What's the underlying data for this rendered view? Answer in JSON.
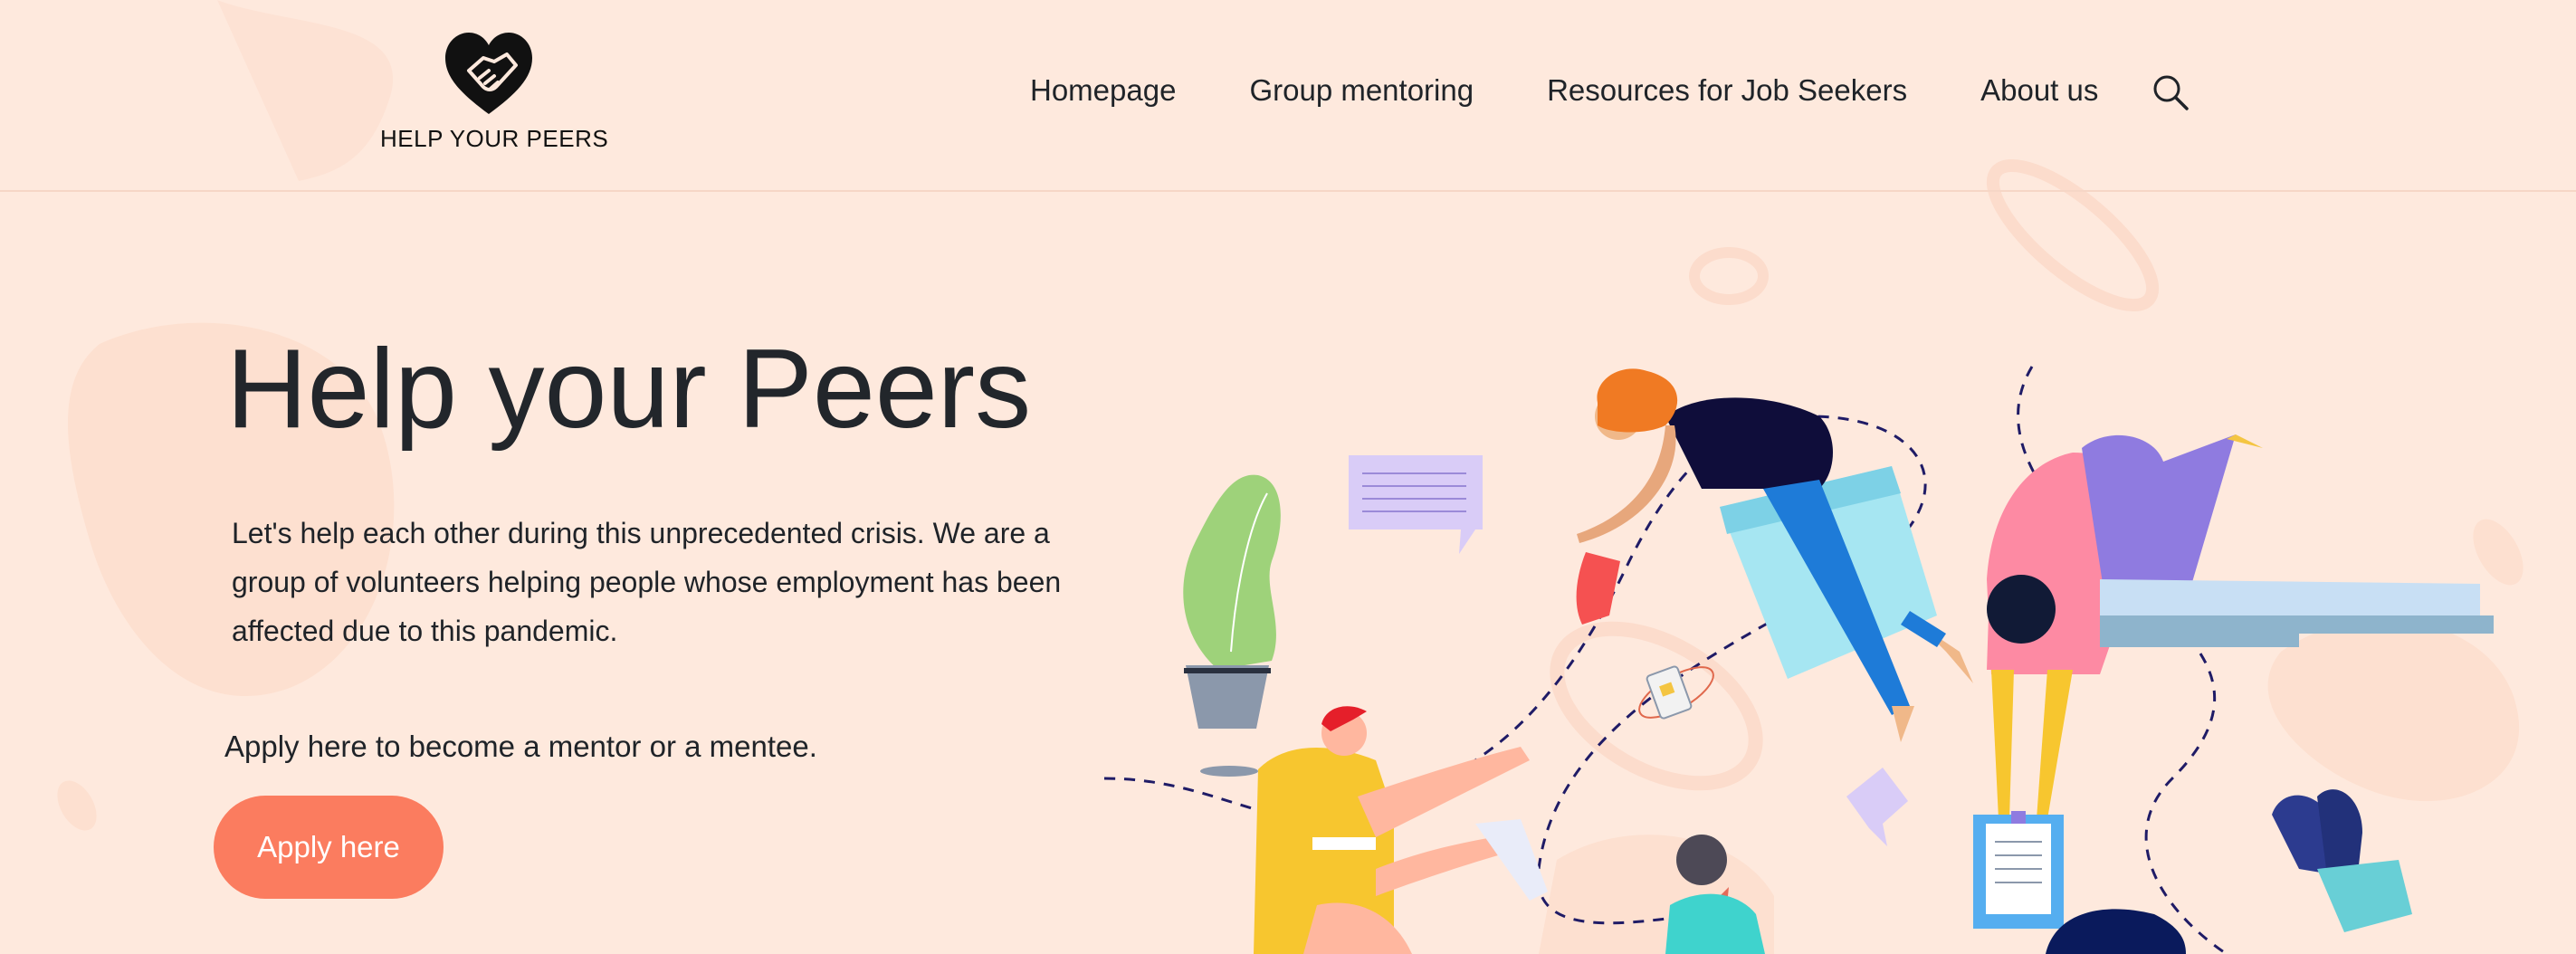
{
  "brand": {
    "logo_text": "HELP YOUR PEERS"
  },
  "nav": {
    "items": [
      {
        "label": "Homepage"
      },
      {
        "label": "Group mentoring"
      },
      {
        "label": "Resources for Job Seekers"
      },
      {
        "label": "About us"
      }
    ],
    "search_icon": "search-icon"
  },
  "hero": {
    "title": "Help your Peers",
    "description": "Let's help each other during this unprecedented crisis. We are a group of volunteers helping people whose employment has been affected due to this pandemic.",
    "apply_note": "Apply here to become a mentor or a mentee.",
    "apply_button": "Apply here"
  },
  "colors": {
    "background": "#fee9dd",
    "accent_button": "#fb7c5f",
    "text": "#1f2328"
  }
}
